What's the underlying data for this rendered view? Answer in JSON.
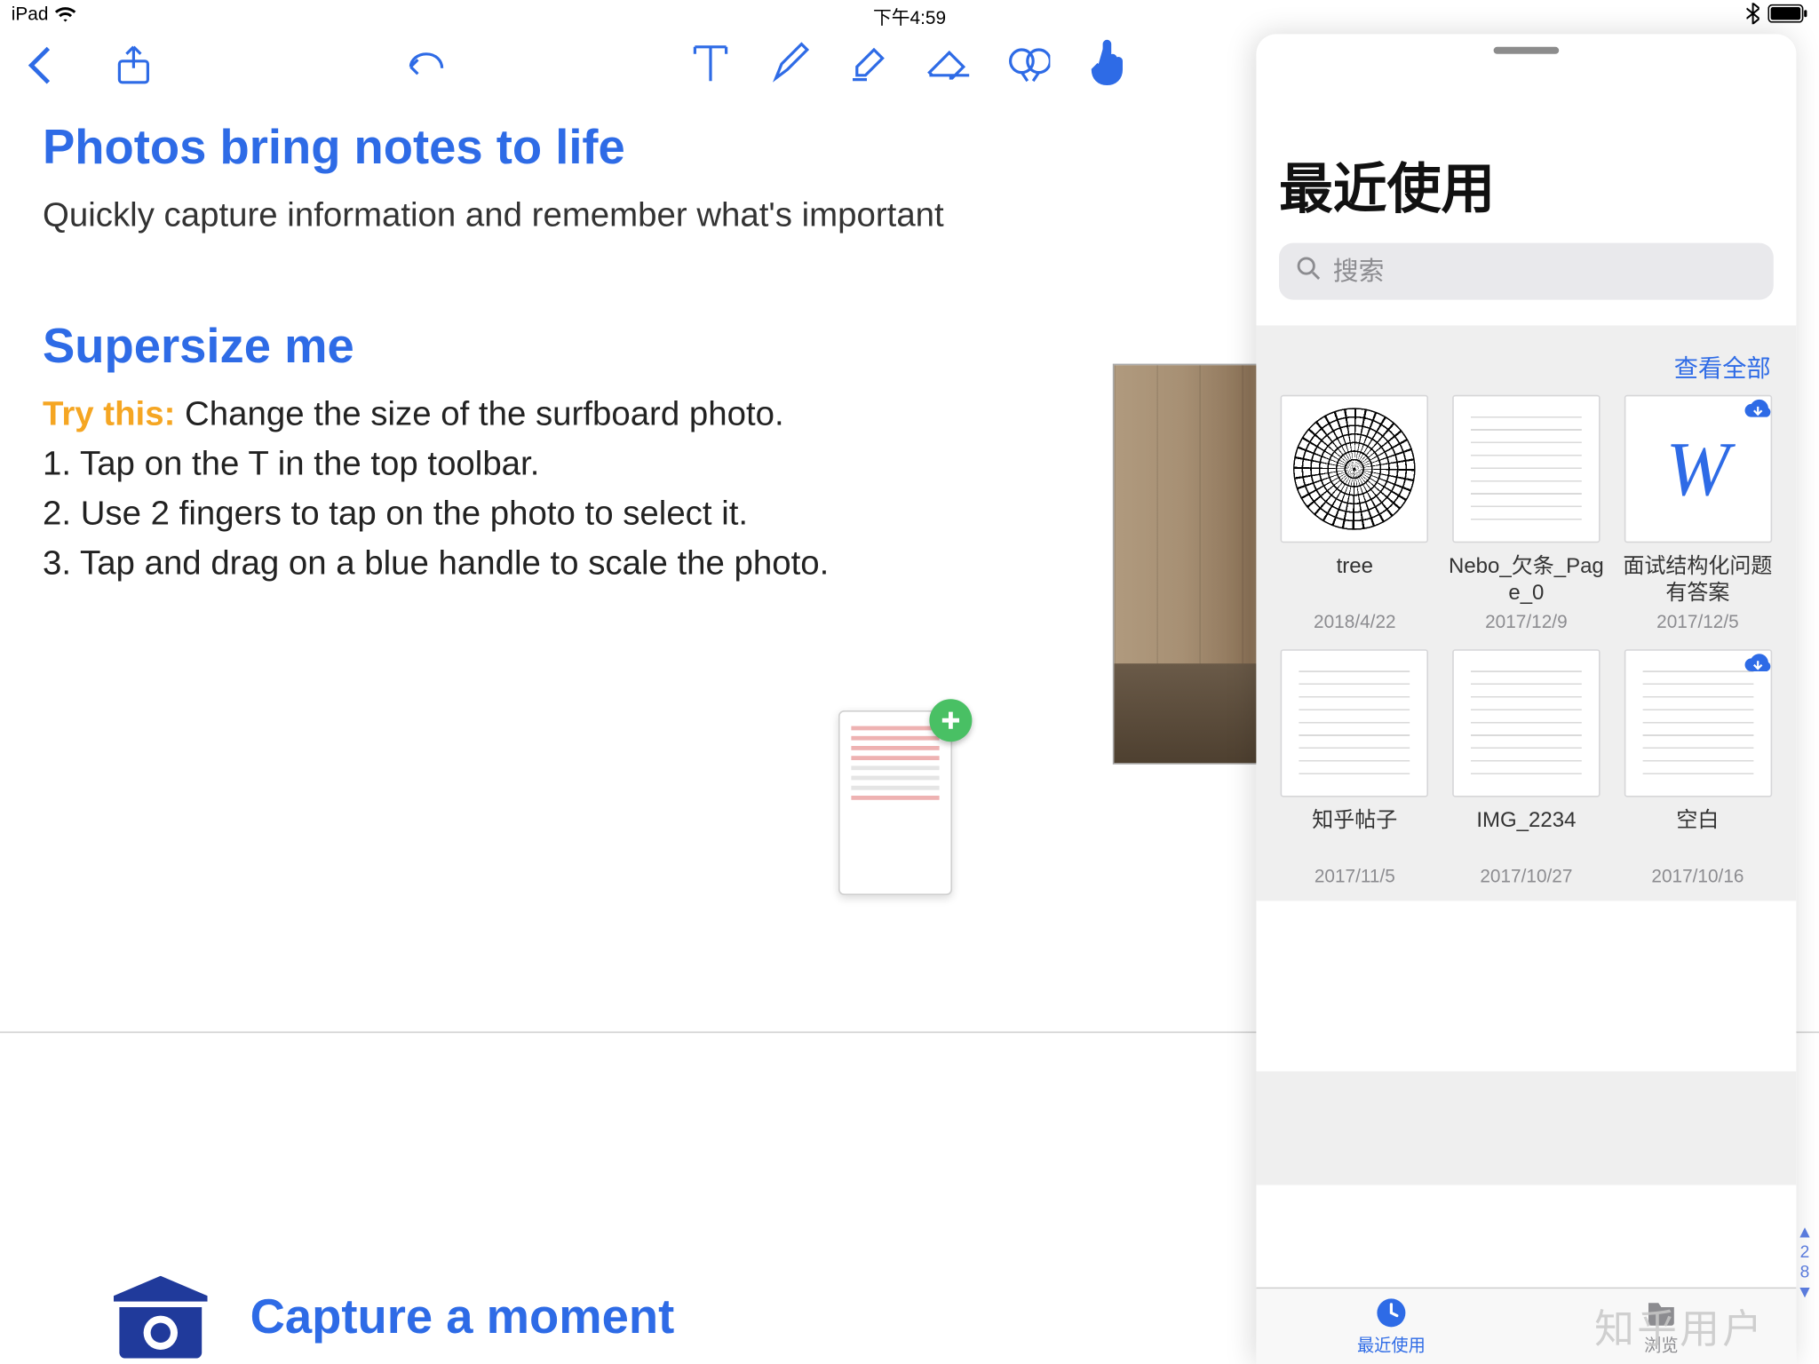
{
  "statusbar": {
    "device": "iPad",
    "time": "下午4:59"
  },
  "note": {
    "h1": "Photos bring notes to life",
    "p1": "Quickly capture information and remember what's important",
    "h2": "Supersize me",
    "try_label": "Try this:",
    "try_rest": " Change the size of the surfboard photo.",
    "step1": "1. Tap on the T in the top toolbar.",
    "step2": "2. Use 2 fingers to tap on the photo to select it.",
    "step3": "3. Tap and drag on a blue handle to scale the photo.",
    "h3": "Capture a moment"
  },
  "panel": {
    "title": "最近使用",
    "search_placeholder": "搜索",
    "view_all": "查看全部",
    "tabs": {
      "recent": "最近使用",
      "browse": "浏览"
    },
    "items": [
      {
        "name": "tree",
        "date": "2018/4/22",
        "kind": "tree",
        "cloud": false
      },
      {
        "name": "Nebo_欠条_Page_0",
        "date": "2017/12/9",
        "kind": "lines",
        "cloud": false
      },
      {
        "name": "面试结构化问题 有答案",
        "date": "2017/12/5",
        "kind": "word",
        "cloud": true
      },
      {
        "name": "知乎帖子",
        "date": "2017/11/5",
        "kind": "lines",
        "cloud": false
      },
      {
        "name": "IMG_2234",
        "date": "2017/10/27",
        "kind": "lines",
        "cloud": false
      },
      {
        "name": "空白",
        "date": "2017/10/16",
        "kind": "lines",
        "cloud": true
      }
    ]
  },
  "edge": {
    "top_num": "2",
    "bot_num": "8"
  },
  "watermark": "知乎用户"
}
